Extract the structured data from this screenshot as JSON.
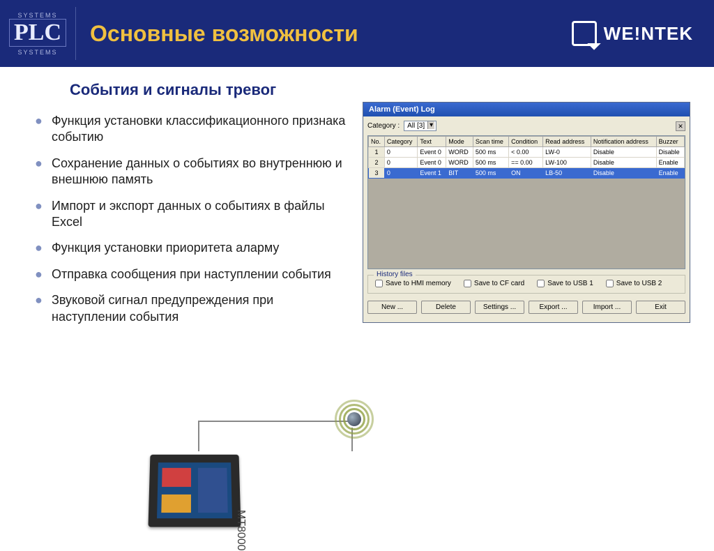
{
  "header": {
    "logo_top": "SYSTEMS",
    "logo_main": "PLC",
    "logo_bottom": "SYSTEMS",
    "title": "Основные возможности",
    "weintek": "WE!NTEK"
  },
  "subtitle": "События и сигналы тревог",
  "bullets": [
    "Функция установки классификационного признака событию",
    "Сохранение данных о событиях во внутреннюю и внешнюю память",
    "Импорт и экспорт данных о событиях в файлы Excel",
    "Функция установки приоритета аларму",
    "Отправка сообщения при наступлении события",
    "Звуковой сигнал предупреждения при наступлении события"
  ],
  "alarm": {
    "titlebar": "Alarm (Event) Log",
    "category_label": "Category :",
    "category_value": "All [3]",
    "columns": [
      "No.",
      "Category",
      "Text",
      "Mode",
      "Scan time",
      "Condition",
      "Read address",
      "Notification address",
      "Buzzer"
    ],
    "rows": [
      {
        "no": "1",
        "category": "0",
        "text": "Event 0",
        "mode": "WORD",
        "scan": "500 ms",
        "cond": "<  0.00",
        "addr": "LW-0",
        "notif": "Disable",
        "buzz": "Disable",
        "selected": false
      },
      {
        "no": "2",
        "category": "0",
        "text": "Event 0",
        "mode": "WORD",
        "scan": "500 ms",
        "cond": "==  0.00",
        "addr": "LW-100",
        "notif": "Disable",
        "buzz": "Enable",
        "selected": false
      },
      {
        "no": "3",
        "category": "0",
        "text": "Event 1",
        "mode": "BIT",
        "scan": "500 ms",
        "cond": "ON",
        "addr": "LB-50",
        "notif": "Disable",
        "buzz": "Enable",
        "selected": true
      }
    ],
    "history_label": "History files",
    "history_checks": [
      "Save to HMI memory",
      "Save to CF card",
      "Save to USB 1",
      "Save to USB 2"
    ],
    "buttons": [
      "New ...",
      "Delete",
      "Settings ...",
      "Export ...",
      "Import ...",
      "Exit"
    ]
  },
  "diagram": {
    "mt_label": "MT8000"
  }
}
